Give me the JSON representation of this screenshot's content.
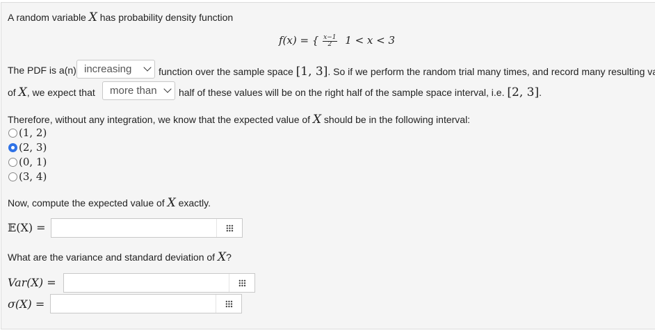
{
  "intro": {
    "pre": "A random variable ",
    "var": "X",
    "post": " has probability density function"
  },
  "pdf": {
    "lhs": "f(x) = {",
    "num": "x−1",
    "den": "2",
    "domain": "1 < x < 3"
  },
  "para1": {
    "line1_pre": "The PDF is a(n)",
    "select1_value": "increasing",
    "line1_mid": "function over the sample space",
    "space": "[1, 3]",
    "line1_post": ". So if we perform the random trial many times, and record many resulting valu",
    "line2_pre": "of ",
    "line2_var": "X",
    "line2_mid": ", we expect that",
    "select2_value": "more than",
    "line2_mid2": "half of these values will be on the right half of the sample space interval, i.e. ",
    "half": "[2, 3]",
    "line2_end": "."
  },
  "question_interval": {
    "pre": "Therefore, without any integration, we know that the expected value of ",
    "var": "X",
    "post": " should be in the following interval:",
    "options": [
      "(1, 2)",
      "(2, 3)",
      "(0, 1)",
      "(3, 4)"
    ],
    "selected_index": 1
  },
  "compute": {
    "pre": "Now, compute the expected value of ",
    "var": "X",
    "post": " exactly.",
    "ex_label": "𝔼(X) =",
    "ex_value": ""
  },
  "variance": {
    "pre": "What are the variance and standard deviation of ",
    "var": "X",
    "post": "?",
    "var_label": "Var(X) =",
    "var_value": "",
    "sd_label": "σ(X) =",
    "sd_value": ""
  },
  "icons": {
    "matrix_input": "grid-dots-icon",
    "select_arrow": "chevron-down-icon"
  },
  "colors": {
    "radio_selected": "#2f72e6",
    "panel_bg": "#f5f5f5"
  }
}
